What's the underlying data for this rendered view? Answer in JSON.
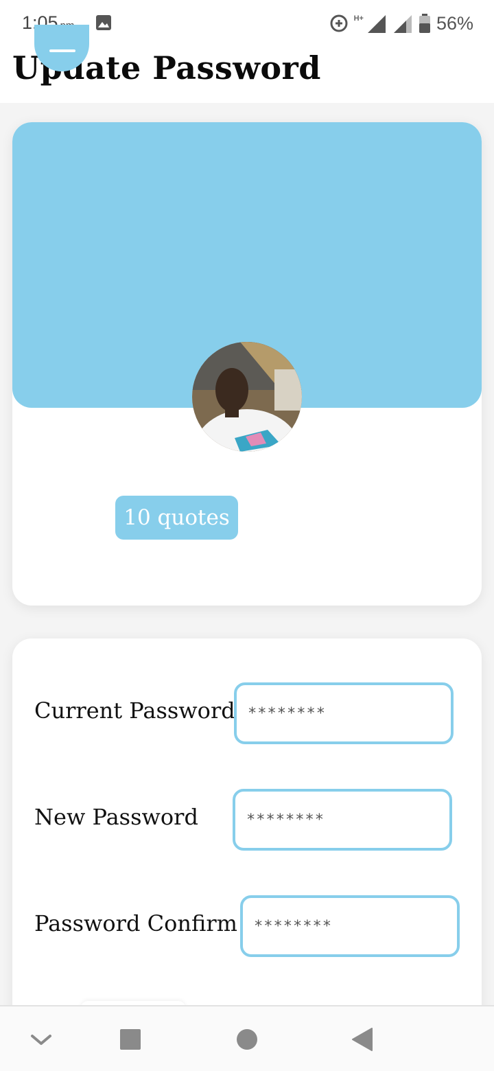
{
  "status_bar": {
    "time": "1:05",
    "ampm": "pm",
    "network_type": "H+",
    "battery_percent": "56%",
    "icons": [
      "gallery-icon",
      "data-saver-icon",
      "signal-icon",
      "signal-icon-2",
      "battery-icon"
    ]
  },
  "page": {
    "title": "Update Password",
    "menu_icon": "menu-icon"
  },
  "profile": {
    "quotes_count_label": "10 quotes",
    "accent_color": "#87ceeb"
  },
  "form": {
    "fields": [
      {
        "label": "Current Password",
        "placeholder": "********"
      },
      {
        "label": "New Password",
        "placeholder": "********"
      },
      {
        "label": "Password Confirm",
        "placeholder": "********"
      }
    ]
  },
  "nav_bar": {
    "icons": [
      "collapse-icon",
      "recents-icon",
      "home-icon",
      "back-icon"
    ]
  }
}
